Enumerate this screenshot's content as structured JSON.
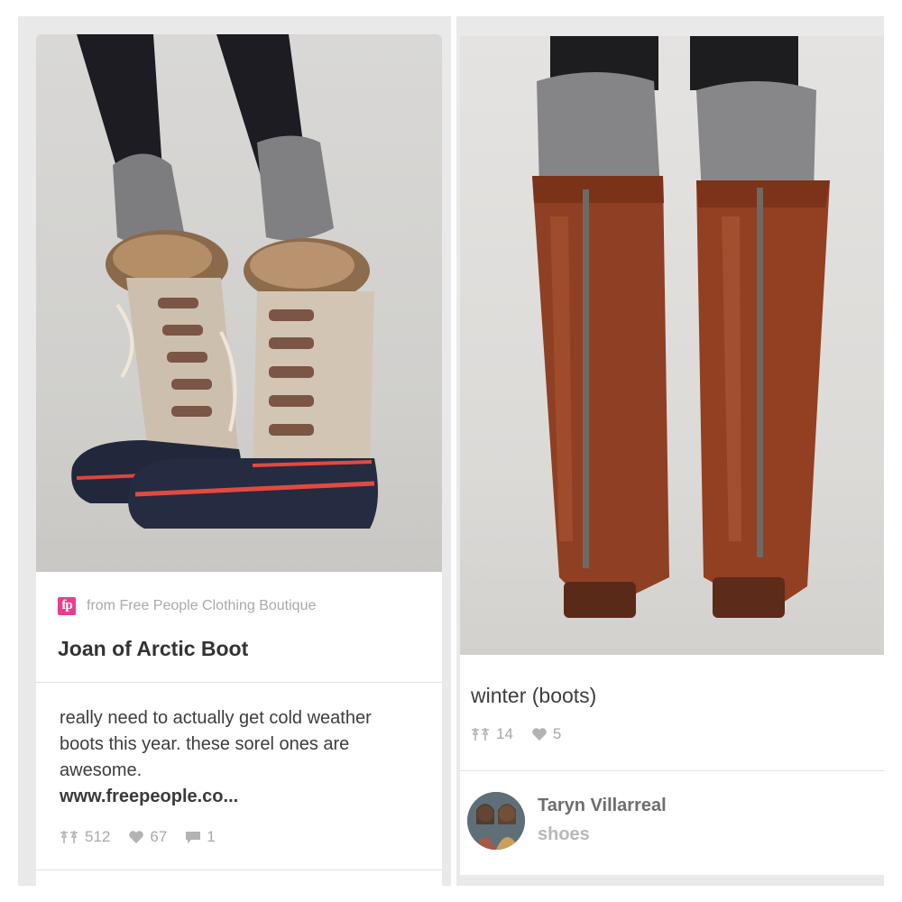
{
  "pins": [
    {
      "image_alt": "Fur-trimmed lace-up winter boots with grey knit socks",
      "source": {
        "logo_text": "fp",
        "text": "from Free People Clothing Boutique"
      },
      "title": "Joan of Arctic Boot",
      "description": "really need to actually get cold weather boots this year. these sorel ones are awesome.",
      "link_text": "www.freepeople.co...",
      "stats": {
        "repins": "512",
        "likes": "67",
        "comments": "1"
      }
    },
    {
      "image_alt": "Tall brown leather boots with back zipper and grey knit socks",
      "title": "winter (boots)",
      "stats": {
        "repins": "14",
        "likes": "5"
      },
      "pinner": {
        "name": "Taryn Villarreal",
        "board": "shoes"
      }
    }
  ],
  "icons": {
    "repin": "pin-icon",
    "like": "heart-icon",
    "comment": "comment-icon"
  },
  "colors": {
    "accent": "#ea3e8c",
    "muted": "#a8a8a8",
    "background": "#e9e9e9"
  }
}
